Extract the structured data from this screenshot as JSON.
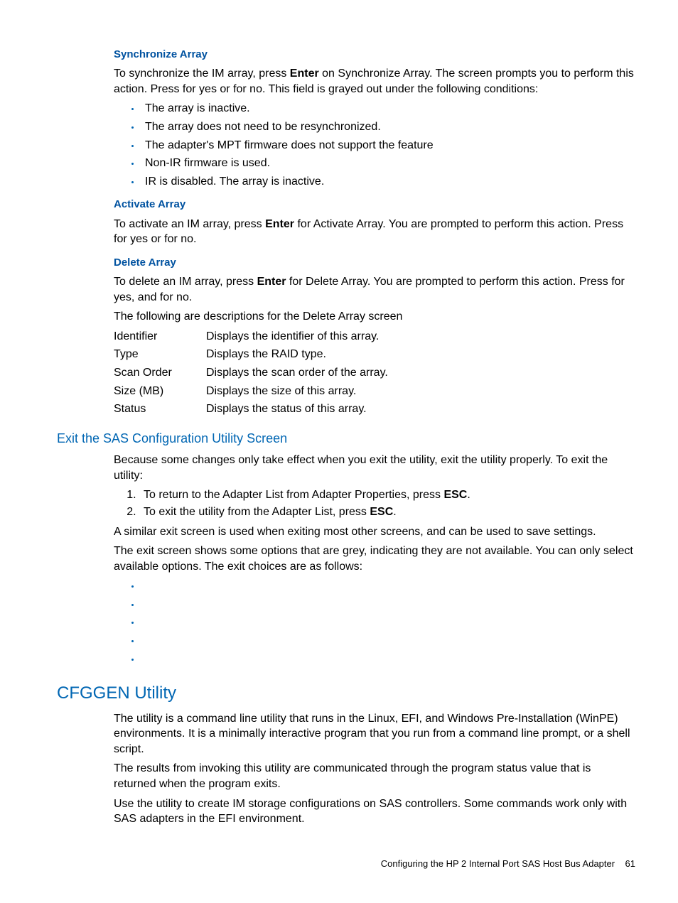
{
  "sections": {
    "sync": {
      "heading": "Synchronize Array",
      "p1_a": "To synchronize the IM array, press ",
      "p1_b": "Enter",
      "p1_c": " on Synchronize Array. The screen prompts you to perform this action. Press   for yes or   for no. This field is grayed out under the following conditions:",
      "bullets": [
        "The array is inactive.",
        "The array does not need to be resynchronized.",
        "The adapter's MPT firmware does not support the feature",
        "Non-IR firmware is used.",
        "IR is disabled. The array is inactive."
      ]
    },
    "activate": {
      "heading": "Activate Array",
      "p1_a": "To activate an IM array, press ",
      "p1_b": "Enter",
      "p1_c": " for Activate Array. You are prompted to perform this action. Press   for yes or   for no."
    },
    "delete": {
      "heading": "Delete Array",
      "p1_a": "To delete an IM array, press ",
      "p1_b": "Enter",
      "p1_c": " for Delete Array. You are prompted to perform this action. Press  for yes, and   for no.",
      "p2": "The following are descriptions for the Delete Array screen",
      "defs": [
        {
          "term": "Identifier",
          "desc": "Displays the identifier of this array."
        },
        {
          "term": "Type",
          "desc": "Displays the RAID type."
        },
        {
          "term": "Scan Order",
          "desc": "Displays the scan order of the array."
        },
        {
          "term": "Size (MB)",
          "desc": "Displays the size of this array."
        },
        {
          "term": "Status",
          "desc": "Displays the status of this array."
        }
      ]
    },
    "exit": {
      "heading": "Exit the SAS Configuration Utility Screen",
      "p1": "Because some changes only take effect when you exit the utility, exit the utility properly. To exit the utility:",
      "step1_a": "To return to the Adapter List from Adapter Properties, press ",
      "step1_b": "ESC",
      "step1_c": ".",
      "step2_a": "To exit the utility from the Adapter List, press ",
      "step2_b": "ESC",
      "step2_c": ".",
      "p2": "A similar exit screen is used when exiting most other screens, and can be used to save settings.",
      "p3": "The exit screen shows some options that are grey, indicating they are not available. You can only select available options. The exit choices are as follows:",
      "bullets": [
        "",
        "",
        "",
        "",
        ""
      ]
    },
    "cfggen": {
      "heading": "CFGGEN Utility",
      "p1": "The           utility is a command line utility that runs in the Linux, EFI, and Windows Pre-Installation (WinPE) environments. It is a minimally interactive program that you run from a command line prompt, or a shell script.",
      "p2": "The results from invoking this utility are communicated through the program status value that is returned when the program exits.",
      "p3": "Use the             utility to create IM storage configurations on SAS controllers. Some commands work only with SAS adapters in the EFI environment."
    }
  },
  "footer": {
    "text": "Configuring the HP 2 Internal Port SAS Host Bus Adapter",
    "page": "61"
  }
}
